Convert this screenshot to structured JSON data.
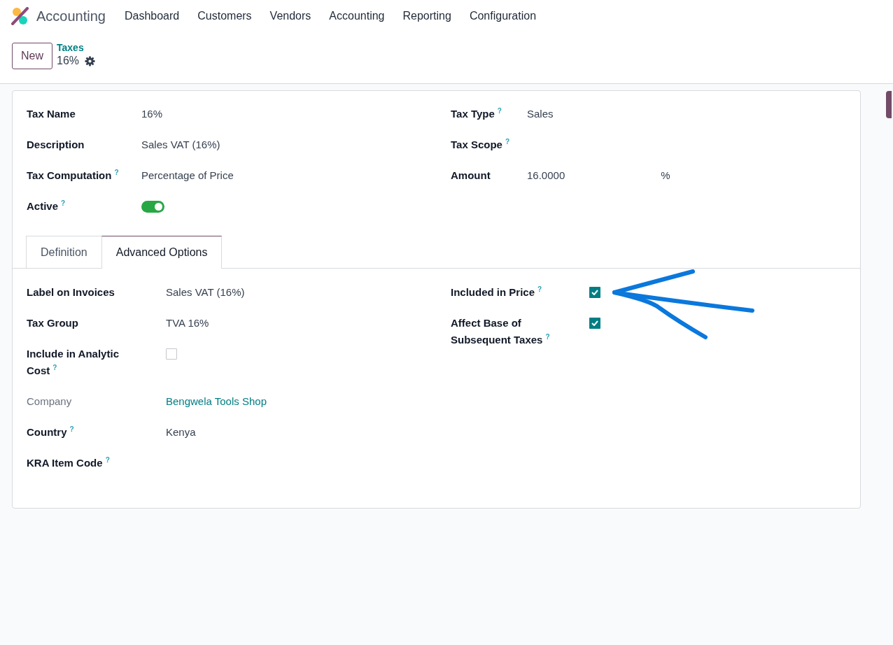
{
  "app": {
    "name": "Accounting"
  },
  "menu": [
    "Dashboard",
    "Customers",
    "Vendors",
    "Accounting",
    "Reporting",
    "Configuration"
  ],
  "control_panel": {
    "new_button": "New",
    "breadcrumb": "Taxes",
    "record": "16%"
  },
  "main_left": [
    {
      "kind": "text",
      "label": "Tax Name",
      "value": "16%"
    },
    {
      "kind": "text",
      "label": "Description",
      "value": "Sales VAT (16%)"
    },
    {
      "kind": "text",
      "label": "Tax Computation",
      "help": "?",
      "value": "Percentage of Price"
    },
    {
      "kind": "toggle",
      "label": "Active",
      "help": "?",
      "on": true
    }
  ],
  "main_right": [
    {
      "kind": "text",
      "label": "Tax Type",
      "help": "?",
      "value": "Sales"
    },
    {
      "kind": "empty",
      "label": "Tax Scope",
      "help": "?"
    },
    {
      "kind": "amount",
      "label": "Amount",
      "value": "16.0000",
      "unit": "%"
    }
  ],
  "tabs": [
    {
      "label": "Definition",
      "selected": false
    },
    {
      "label": "Advanced Options",
      "selected": true
    }
  ],
  "advanced_left": [
    {
      "kind": "text",
      "label": "Label on Invoices",
      "readonly": false,
      "value": "Sales VAT (16%)"
    },
    {
      "kind": "text",
      "label": "Tax Group",
      "readonly": false,
      "value": "TVA 16%"
    },
    {
      "kind": "checkbox",
      "label": "Include in Analytic Cost",
      "help": "?",
      "readonly": false,
      "checked": false
    },
    {
      "kind": "link",
      "label": "Company",
      "readonly": true,
      "value": "Bengwela Tools Shop"
    },
    {
      "kind": "text",
      "label": "Country",
      "help": "?",
      "readonly": false,
      "value": "Kenya"
    },
    {
      "kind": "empty",
      "label": "KRA Item Code",
      "help": "?",
      "readonly": false
    }
  ],
  "advanced_right": [
    {
      "kind": "checkbox",
      "label": "Included in Price",
      "help": "?",
      "checked": true
    },
    {
      "kind": "checkbox",
      "label": "Affect Base of Subsequent Taxes",
      "help": "?",
      "checked": true
    }
  ]
}
